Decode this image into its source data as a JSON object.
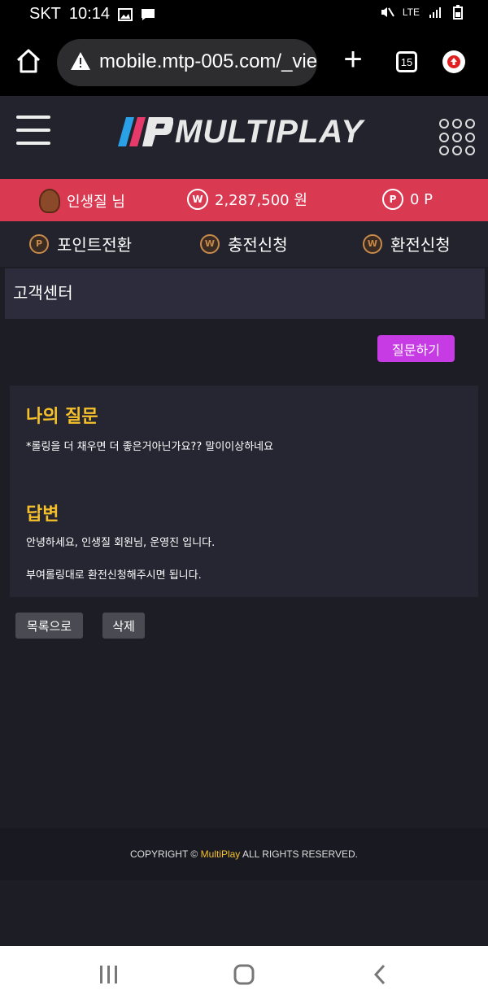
{
  "status": {
    "carrier": "SKT",
    "time": "10:14",
    "network": "LTE"
  },
  "browser": {
    "url": "mobile.mtp-005.com/_vie",
    "tab_count": "15"
  },
  "header": {
    "logo_text": "MULTIPLAY"
  },
  "user": {
    "name": "인생질 님",
    "money": "2,287,500 원",
    "points": "0 P"
  },
  "actions": {
    "points_convert": "포인트전환",
    "deposit": "충전신청",
    "withdraw": "환전신청"
  },
  "page": {
    "title": "고객센터",
    "ask_button": "질문하기"
  },
  "question": {
    "heading": "나의 질문",
    "text": "*롤링을 더 채우면 더 좋은거아닌가요?? 말이이상하네요"
  },
  "answer": {
    "heading": "답변",
    "line1": "안녕하세요, 인생질 회원님, 운영진 입니다.",
    "line2": "부여롤링대로 환전신청해주시면 됩니다."
  },
  "buttons": {
    "list": "목록으로",
    "delete": "삭제"
  },
  "footer": {
    "prefix": "COPYRIGHT © ",
    "brand": "MultiPlay",
    "suffix": " ALL RIGHTS RESERVED."
  },
  "colors": {
    "accent_red": "#d93a52",
    "accent_purple": "#c63be3",
    "gold": "#f5c02a",
    "bg": "#1d1d26"
  }
}
